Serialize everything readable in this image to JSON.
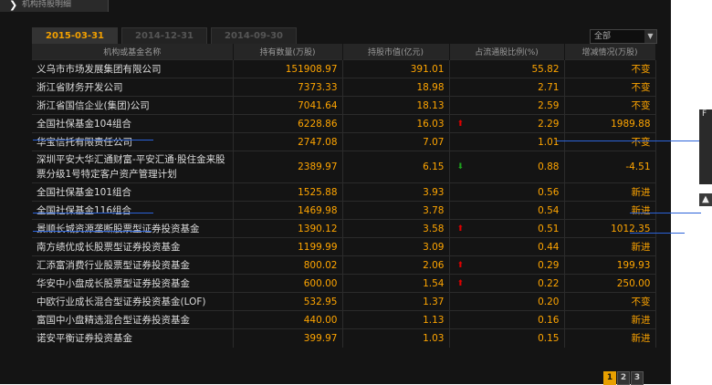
{
  "header": {
    "title": "机构持股明细"
  },
  "tabs": [
    "2015-03-31",
    "2014-12-31",
    "2014-09-30"
  ],
  "filter": {
    "selected": "全部"
  },
  "table": {
    "columns": [
      "机构或基金名称",
      "持有数量(万股)",
      "持股市值(亿元)",
      "占流通股比例(%)",
      "增减情况(万股)"
    ],
    "rows": [
      {
        "name": "义乌市市场发展集团有限公司",
        "shares": "151908.97",
        "value": "391.01",
        "ratio": "55.82",
        "change": "不变",
        "dir": ""
      },
      {
        "name": "浙江省财务开发公司",
        "shares": "7373.33",
        "value": "18.98",
        "ratio": "2.71",
        "change": "不变",
        "dir": ""
      },
      {
        "name": "浙江省国信企业(集团)公司",
        "shares": "7041.64",
        "value": "18.13",
        "ratio": "2.59",
        "change": "不变",
        "dir": ""
      },
      {
        "name": "全国社保基金104组合",
        "shares": "6228.86",
        "value": "16.03",
        "ratio": "2.29",
        "change": "1989.88",
        "dir": "up"
      },
      {
        "name": "华宝信托有限责任公司",
        "shares": "2747.08",
        "value": "7.07",
        "ratio": "1.01",
        "change": "不变",
        "dir": ""
      },
      {
        "name": "深圳平安大华汇通财富-平安汇通·股住金来股票分级1号特定客户资产管理计划",
        "shares": "2389.97",
        "value": "6.15",
        "ratio": "0.88",
        "change": "-4.51",
        "dir": "down"
      },
      {
        "name": "全国社保基金101组合",
        "shares": "1525.88",
        "value": "3.93",
        "ratio": "0.56",
        "change": "新进",
        "dir": ""
      },
      {
        "name": "全国社保基金116组合",
        "shares": "1469.98",
        "value": "3.78",
        "ratio": "0.54",
        "change": "新进",
        "dir": ""
      },
      {
        "name": "景顺长城资源垄断股票型证券投资基金",
        "shares": "1390.12",
        "value": "3.58",
        "ratio": "0.51",
        "change": "1012.35",
        "dir": "up"
      },
      {
        "name": "南方绩优成长股票型证券投资基金",
        "shares": "1199.99",
        "value": "3.09",
        "ratio": "0.44",
        "change": "新进",
        "dir": ""
      },
      {
        "name": "汇添富消费行业股票型证券投资基金",
        "shares": "800.02",
        "value": "2.06",
        "ratio": "0.29",
        "change": "199.93",
        "dir": "up"
      },
      {
        "name": "华安中小盘成长股票型证券投资基金",
        "shares": "600.00",
        "value": "1.54",
        "ratio": "0.22",
        "change": "250.00",
        "dir": "up"
      },
      {
        "name": "中欧行业成长混合型证券投资基金(LOF)",
        "shares": "532.95",
        "value": "1.37",
        "ratio": "0.20",
        "change": "不变",
        "dir": ""
      },
      {
        "name": "富国中小盘精选混合型证券投资基金",
        "shares": "440.00",
        "value": "1.13",
        "ratio": "0.16",
        "change": "新进",
        "dir": ""
      },
      {
        "name": "诺安平衡证券投资基金",
        "shares": "399.97",
        "value": "1.03",
        "ratio": "0.15",
        "change": "新进",
        "dir": ""
      }
    ]
  },
  "pager": [
    "1",
    "2",
    "3"
  ],
  "side_panel": {
    "letter": "F"
  },
  "icons": {
    "up": "arrow-up-icon",
    "down": "arrow-down-icon",
    "dropdown": "chevron-down-icon",
    "title": "chevron-right-icon"
  },
  "colors": {
    "accent": "#f2a000",
    "up": "#e10000",
    "down": "#1ea21e",
    "underline": "#2b63d9"
  }
}
